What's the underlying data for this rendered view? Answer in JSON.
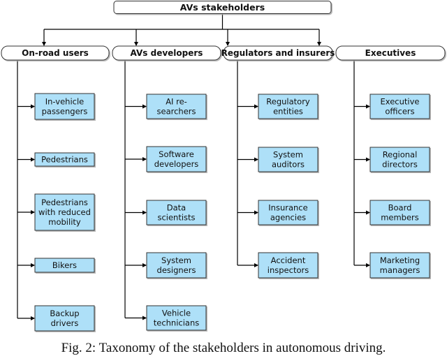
{
  "root": {
    "label": "AVs stakeholders"
  },
  "categories": [
    {
      "label": "On-road users",
      "children": [
        [
          "In-vehicle",
          "passengers"
        ],
        [
          "Pedestrians"
        ],
        [
          "Pedestrians",
          "with reduced",
          "mobility"
        ],
        [
          "Bikers"
        ],
        [
          "Backup",
          "drivers"
        ]
      ]
    },
    {
      "label": "AVs developers",
      "children": [
        [
          "AI re-",
          "searchers"
        ],
        [
          "Software",
          "developers"
        ],
        [
          "Data",
          "scientists"
        ],
        [
          "System",
          "designers"
        ],
        [
          "Vehicle",
          "technicians"
        ]
      ]
    },
    {
      "label": "Regulators and insurers",
      "children": [
        [
          "Regulatory",
          "entities"
        ],
        [
          "System",
          "auditors"
        ],
        [
          "Insurance",
          "agencies"
        ],
        [
          "Accident",
          "inspectors"
        ]
      ]
    },
    {
      "label": "Executives",
      "children": [
        [
          "Executive",
          "officers"
        ],
        [
          "Regional",
          "directors"
        ],
        [
          "Board",
          "members"
        ],
        [
          "Marketing",
          "managers"
        ]
      ]
    }
  ],
  "colors": {
    "leaf_fill": "#aee0f8",
    "line": "#000000",
    "box_border": "#333333"
  },
  "caption": "Fig. 2: Taxonomy of the stakeholders in autonomous driving."
}
